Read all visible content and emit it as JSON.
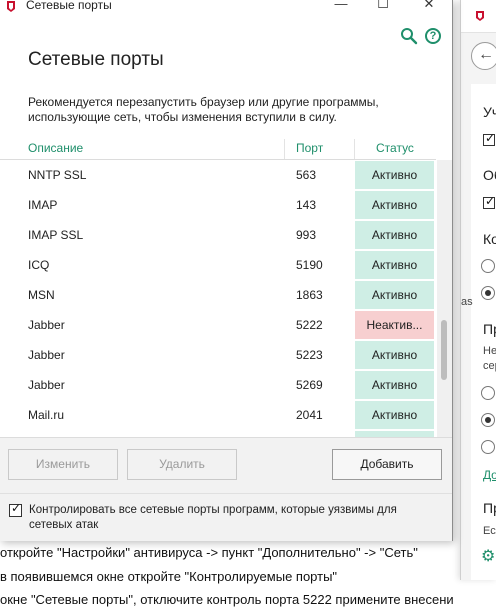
{
  "dialog": {
    "window_title": "Сетевые порты",
    "heading": "Сетевые порты",
    "notice": "Рекомендуется перезапустить браузер или другие программы, использующие сеть, чтобы изменения вступили в силу.",
    "columns": {
      "description": "Описание",
      "port": "Порт",
      "status": "Статус"
    },
    "rows": [
      {
        "name": "NNTP SSL",
        "port": "563",
        "status": "Активно",
        "state": "active"
      },
      {
        "name": "IMAP",
        "port": "143",
        "status": "Активно",
        "state": "active"
      },
      {
        "name": "IMAP SSL",
        "port": "993",
        "status": "Активно",
        "state": "active"
      },
      {
        "name": "ICQ",
        "port": "5190",
        "status": "Активно",
        "state": "active"
      },
      {
        "name": "MSN",
        "port": "1863",
        "status": "Активно",
        "state": "active"
      },
      {
        "name": "Jabber",
        "port": "5222",
        "status": "Неактив...",
        "state": "inactive"
      },
      {
        "name": "Jabber",
        "port": "5223",
        "status": "Активно",
        "state": "active"
      },
      {
        "name": "Jabber",
        "port": "5269",
        "status": "Активно",
        "state": "active"
      },
      {
        "name": "Mail.ru",
        "port": "2041",
        "status": "Активно",
        "state": "active"
      }
    ],
    "buttons": {
      "edit": "Изменить",
      "delete": "Удалить",
      "add": "Добавить"
    },
    "footer_checkbox": "Контролировать все сетевые порты программ, которые уязвимы для сетевых атак",
    "icons": {
      "search": "search-icon",
      "help": "help-icon"
    },
    "colors": {
      "accent": "#1f8f6b",
      "active": "#cfeee5",
      "inactive": "#f7cfd0"
    }
  },
  "background_text": [
    "откройте \"Настройки\" антивируса -> пункт \"Дополнительно\" -> \"Сеть\"",
    "в появившемся окне откройте \"Контролируемые порты\"",
    "окне \"Сетевые порты\", отключите контроль порта 5222 примените внесени"
  ],
  "right_panel": {
    "labels": [
      "Уч",
      "Об",
      "Ко",
      "Пр",
      "Не",
      "сер",
      "Дo",
      "Пр",
      "Есл",
      "as"
    ]
  }
}
